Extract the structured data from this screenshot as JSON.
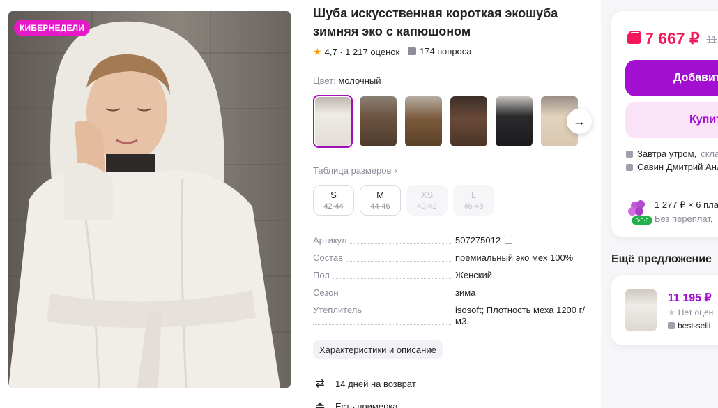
{
  "product": {
    "badge": "КИБЕРНЕДЕЛИ",
    "title": "Шуба искусственная короткая экошуба зимняя эко с капюшоном",
    "rating": "4,7 · 1 217 оценок",
    "questions": "174 вопроса",
    "color_label": "Цвет:",
    "color_value": "молочный",
    "size_table_label": "Таблица размеров",
    "sizes": [
      {
        "size": "S",
        "ru": "42-44",
        "available": true
      },
      {
        "size": "M",
        "ru": "44-46",
        "available": true
      },
      {
        "size": "XS",
        "ru": "40-42",
        "available": false
      },
      {
        "size": "L",
        "ru": "46-48",
        "available": false
      }
    ],
    "specs": [
      {
        "key": "Артикул",
        "value": "507275012"
      },
      {
        "key": "Состав",
        "value": "премиальный эко мех 100%"
      },
      {
        "key": "Пол",
        "value": "Женский"
      },
      {
        "key": "Сезон",
        "value": "зима"
      },
      {
        "key": "Утеплитель",
        "value": "isosoft; Плотность меха 1200 г/м3."
      }
    ],
    "description_button": "Характеристики и описание",
    "features": [
      {
        "icon": "return-arrows-icon",
        "text": "14 дней на возврат"
      },
      {
        "icon": "hanger-icon",
        "text": "Есть примерка"
      }
    ]
  },
  "thumbnails": [
    {
      "color": "#e9e5df"
    },
    {
      "color": "#6e5541"
    },
    {
      "color": "#7a5a3c"
    },
    {
      "color": "#6a4a38"
    },
    {
      "color": "#2a2a2c"
    },
    {
      "color": "#d9c7b0"
    }
  ],
  "buy_card": {
    "price": "7 667 ₽",
    "old_price": "11",
    "add_button": "Добавит",
    "buy_button": "Купит",
    "delivery": "Завтра утром,",
    "delivery_gray": "скла",
    "seller": "Савин Дмитрий Анд",
    "installment": "1 277 ₽ × 6 пла",
    "installment_note": "Без переплат,",
    "installment_badge": "0·0·6"
  },
  "other_offer": {
    "title": "Ещё предложение",
    "price": "11 195 ₽",
    "rating": "Нет оцен",
    "seller": "best-selli"
  },
  "colors": {
    "accent": "#a20fd0",
    "price": "#f2185a",
    "badge": "#e718c7"
  }
}
